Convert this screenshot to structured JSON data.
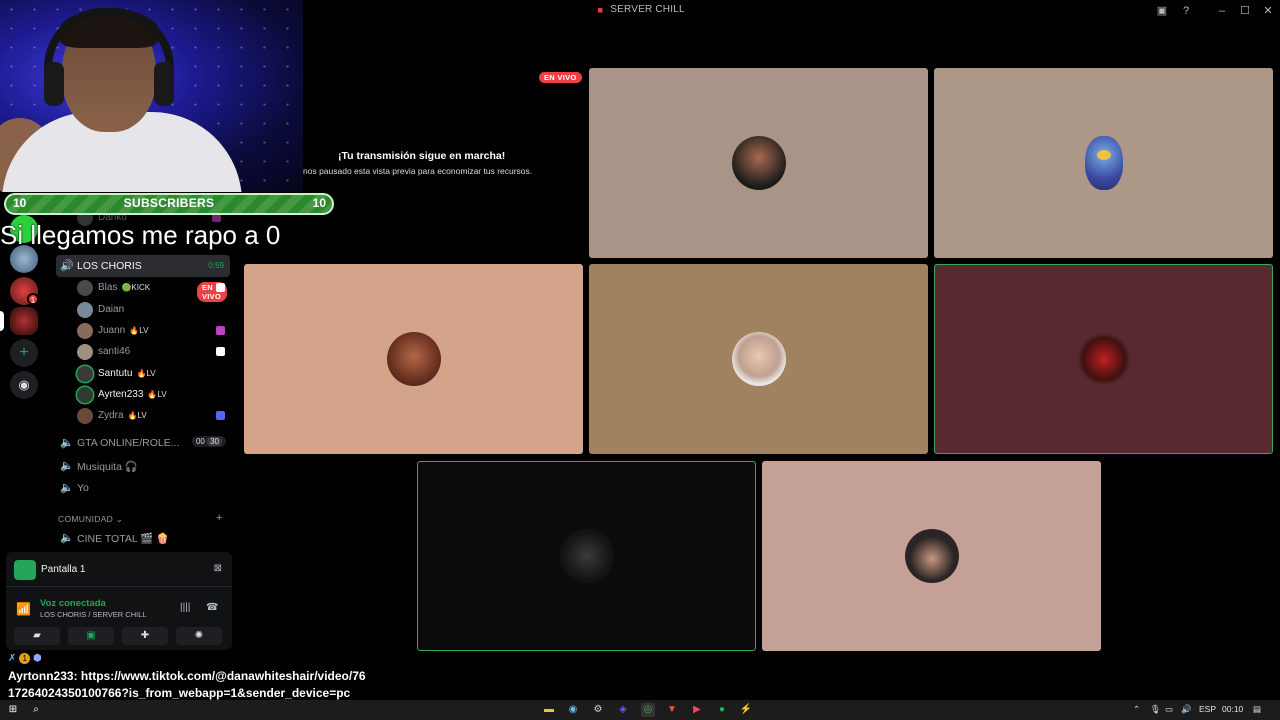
{
  "window": {
    "title": "SERVER CHILL"
  },
  "overlay": {
    "sub_goal": {
      "current": "10",
      "label": "SUBSCRIBERS",
      "target": "10"
    },
    "caption": "Si llegamos me rapo a 0"
  },
  "sidebar": {
    "partial_user": "Danko",
    "active_channel": {
      "name": "LOS CHORIS",
      "timer": "0:59"
    },
    "voice_users": [
      {
        "name": "Blas",
        "tag": "KICK",
        "live": "EN VIVO"
      },
      {
        "name": "Daian",
        "tag": ""
      },
      {
        "name": "Juann",
        "tag": "LV"
      },
      {
        "name": "santi46",
        "tag": ""
      },
      {
        "name": "Santutu",
        "tag": "LV"
      },
      {
        "name": "Ayrten233",
        "tag": "LV"
      },
      {
        "name": "Zydra",
        "tag": "LV"
      }
    ],
    "channels": [
      {
        "name": "GTA ONLINE/ROLE...",
        "count_a": "00",
        "count_b": "30"
      },
      {
        "name": "Musiquita 🎧"
      },
      {
        "name": "Yo"
      }
    ],
    "category": "COMUNIDAD",
    "cine_channel": "CINE TOTAL 🎬 🍿"
  },
  "voice_panel": {
    "screen_label": "Pantalla 1",
    "status": "Voz conectada",
    "location": "LOS CHORIS / SERVER CHILL"
  },
  "stream": {
    "live_badge": "EN VIVO",
    "title": "¡Tu transmisión sigue en marcha!",
    "subtitle": "nos pausado esta vista previa para economizar tus recursos."
  },
  "chat": {
    "message": "Ayrtonn233: https://www.tiktok.com/@danawhiteshair/video/7617264024350100766?is_from_webapp=1&sender_device=pc",
    "message_line1": "Ayrtonn233: https://www.tiktok.com/@danawhiteshair/video/76",
    "message_line2": "17264024350100766?is_from_webapp=1&sender_device=pc",
    "badge_count": "1"
  },
  "taskbar": {
    "language": "ESP",
    "time": "00:10"
  },
  "colors": {
    "live": "#ed4245",
    "speaking": "#3ba55c",
    "online": "#23a55a"
  }
}
